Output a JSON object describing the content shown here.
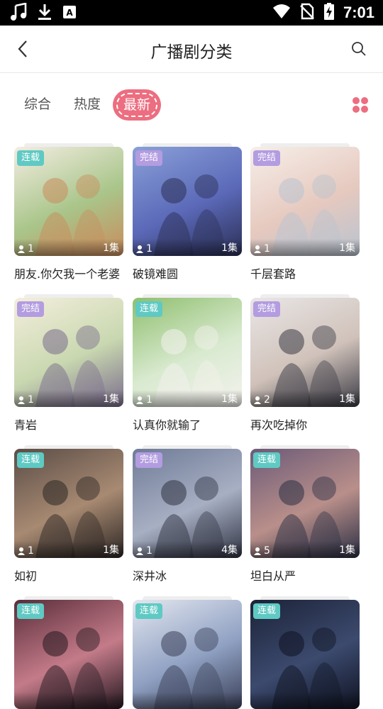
{
  "status_bar": {
    "time": "7:01"
  },
  "header": {
    "title": "广播剧分类"
  },
  "tabs": [
    {
      "label": "综合",
      "active": false
    },
    {
      "label": "热度",
      "active": false
    },
    {
      "label": "最新",
      "active": true
    }
  ],
  "items": [
    {
      "title": "朋友.你欠我一个老婆",
      "status": "连载",
      "plays": "1",
      "episodes": "1集",
      "colors": [
        "#f3ede2",
        "#a9c58a",
        "#c98c5c"
      ]
    },
    {
      "title": "破镜难圆",
      "status": "完结",
      "plays": "1",
      "episodes": "1集",
      "colors": [
        "#8aa0d8",
        "#5b69b8",
        "#2b2f55"
      ]
    },
    {
      "title": "千层套路",
      "status": "完结",
      "plays": "1",
      "episodes": "1集",
      "colors": [
        "#f6efe9",
        "#e6c9bf",
        "#b9c3cf"
      ]
    },
    {
      "title": "青岩",
      "status": "完结",
      "plays": "1",
      "episodes": "1集",
      "colors": [
        "#f4eedd",
        "#c9d8b0",
        "#7a6c8c"
      ]
    },
    {
      "title": "认真你就输了",
      "status": "连载",
      "plays": "1",
      "episodes": "1集",
      "colors": [
        "#8fbf6e",
        "#d9ead0",
        "#f4f2ee"
      ]
    },
    {
      "title": "再次吃掉你",
      "status": "完结",
      "plays": "2",
      "episodes": "1集",
      "colors": [
        "#e9e6e6",
        "#d0c2ba",
        "#3a3a44"
      ]
    },
    {
      "title": "如初",
      "status": "连载",
      "plays": "1",
      "episodes": "1集",
      "colors": [
        "#5a4d47",
        "#a88a72",
        "#2c2624"
      ]
    },
    {
      "title": "深井冰",
      "status": "完结",
      "plays": "1",
      "episodes": "4集",
      "colors": [
        "#6f7b97",
        "#a7afc3",
        "#2f3342"
      ]
    },
    {
      "title": "坦白从严",
      "status": "连载",
      "plays": "5",
      "episodes": "1集",
      "colors": [
        "#6b5a78",
        "#b98f8a",
        "#2b2f44"
      ]
    },
    {
      "title": "",
      "status": "连载",
      "plays": "",
      "episodes": "",
      "colors": [
        "#5a2d3a",
        "#c47b89",
        "#241820"
      ]
    },
    {
      "title": "",
      "status": "连载",
      "plays": "",
      "episodes": "",
      "colors": [
        "#e3e7f0",
        "#8fa0c2",
        "#3a4058"
      ]
    },
    {
      "title": "",
      "status": "连载",
      "plays": "",
      "episodes": "",
      "colors": [
        "#1c2338",
        "#3c4a6e",
        "#0f1322"
      ]
    }
  ]
}
